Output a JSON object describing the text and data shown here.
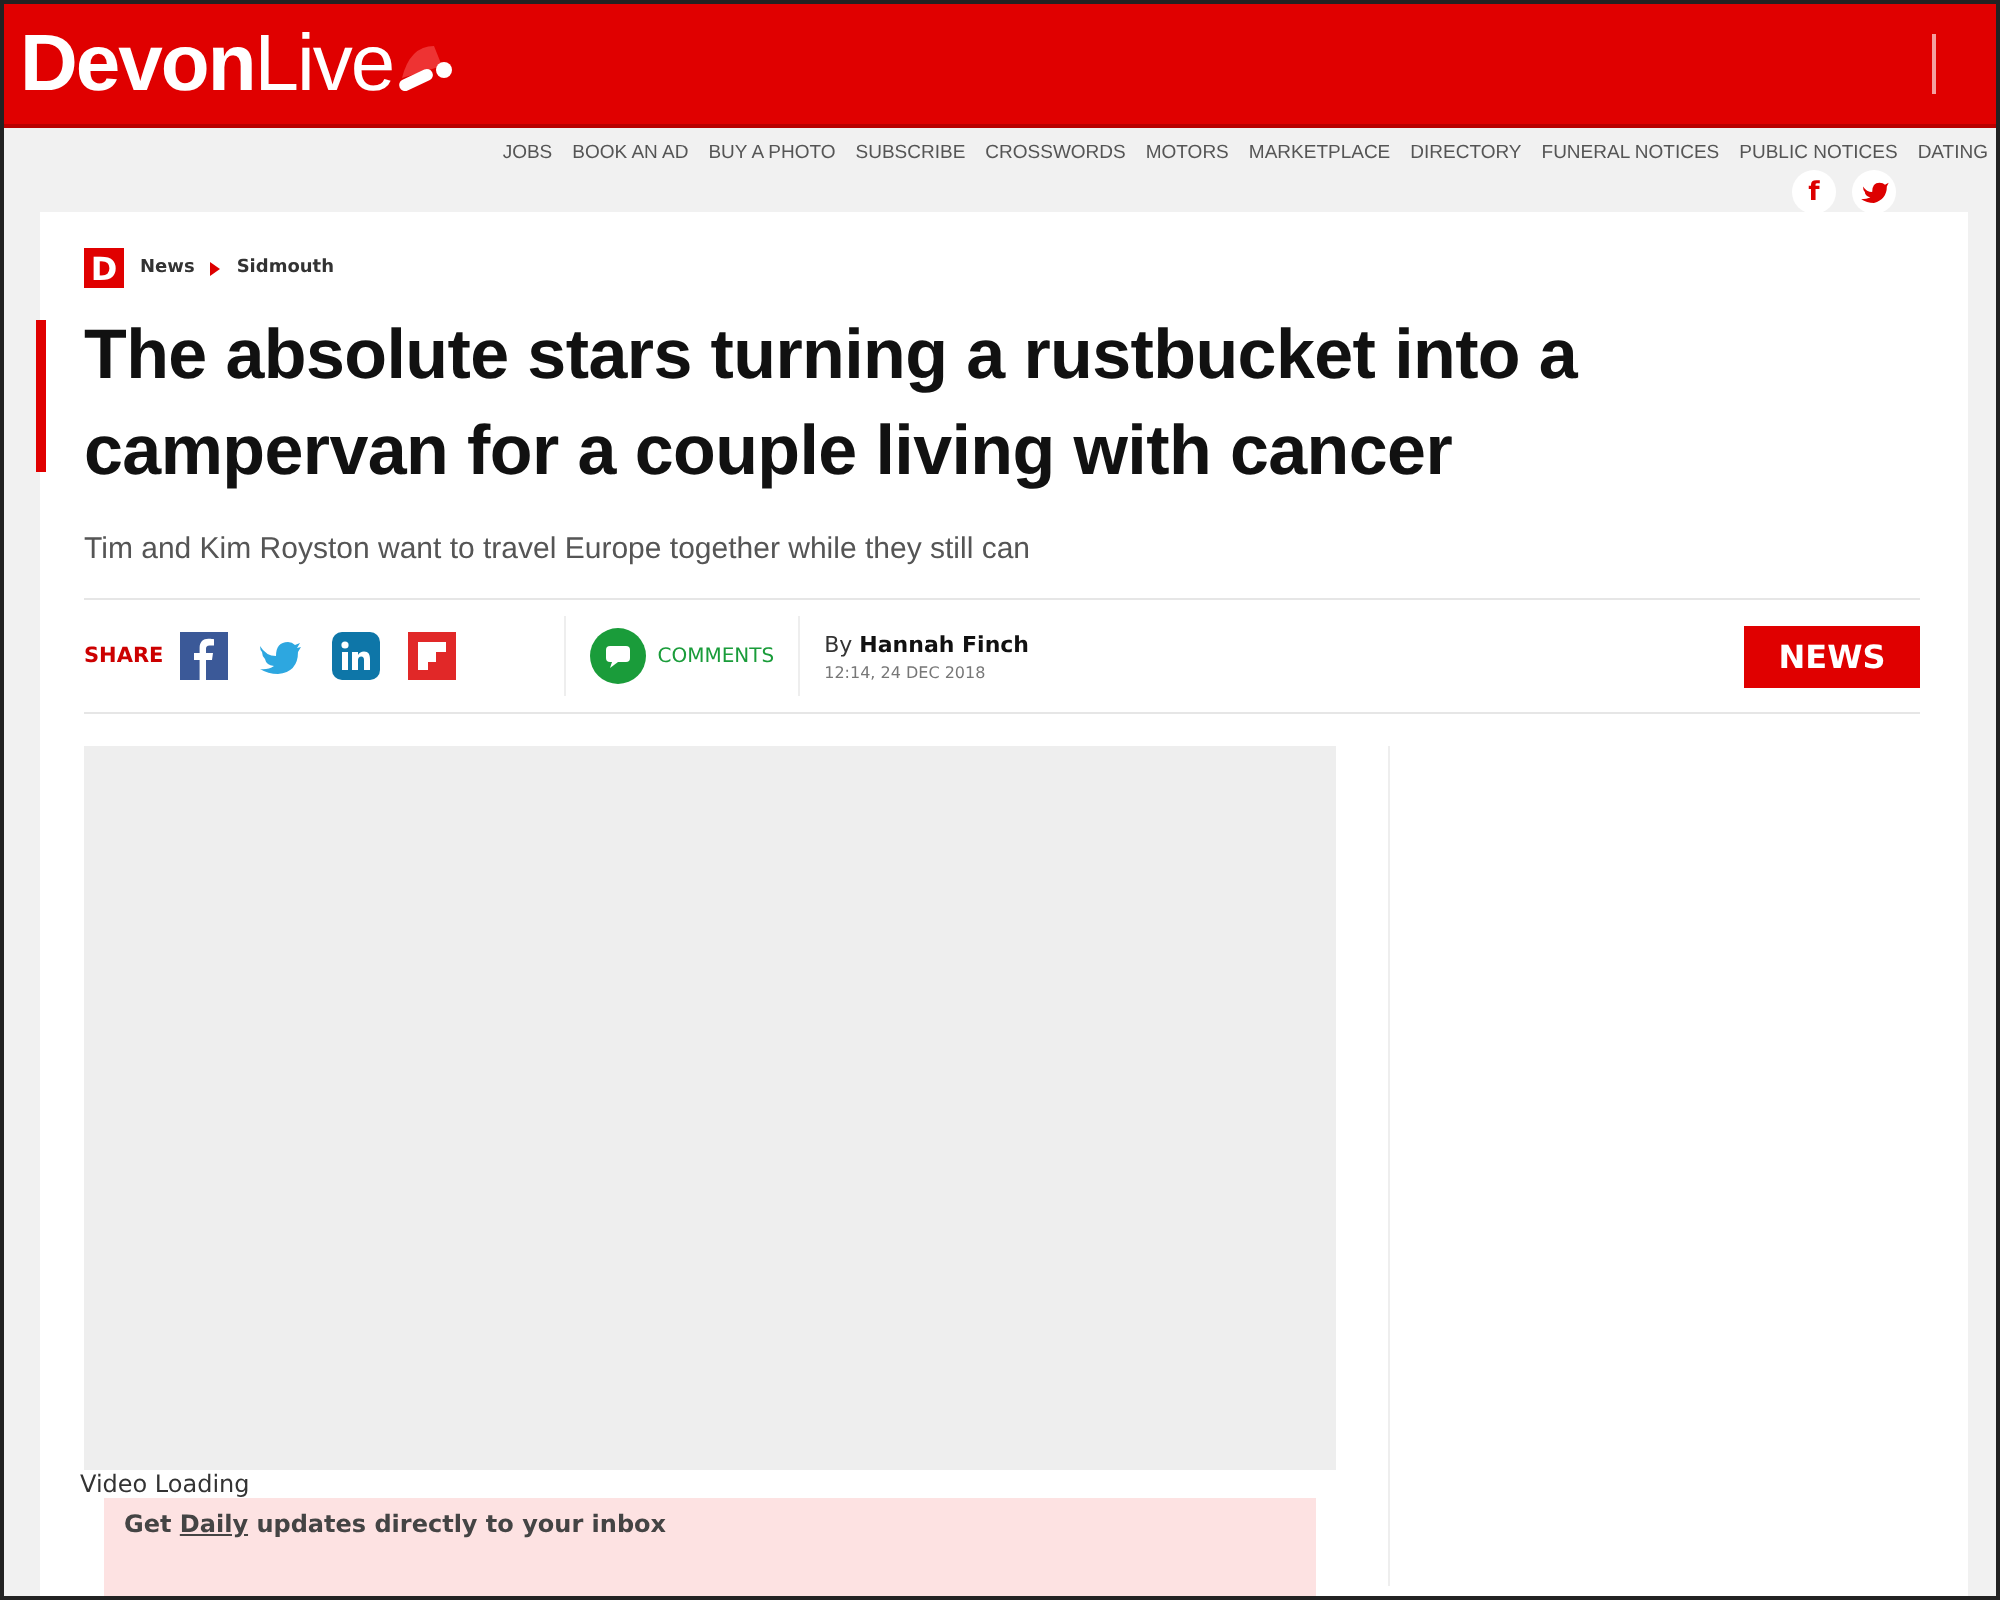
{
  "header": {
    "logo_main": "Devon",
    "logo_accent": "Live"
  },
  "top_links": [
    "JOBS",
    "BOOK AN AD",
    "BUY A PHOTO",
    "SUBSCRIBE",
    "CROSSWORDS",
    "MOTORS",
    "MARKETPLACE",
    "DIRECTORY",
    "FUNERAL NOTICES",
    "PUBLIC NOTICES",
    "DATING"
  ],
  "social": [
    "f"
  ],
  "breadcrumb": {
    "badge": "D",
    "items": [
      "News",
      "Sidmouth"
    ]
  },
  "article": {
    "headline": "The absolute stars turning a rustbucket into a campervan for a couple living with cancer",
    "standfirst": "Tim and Kim Royston want to travel Europe together while they still can",
    "share_label": "SHARE",
    "comments_label": "COMMENTS",
    "byline_prefix": "By",
    "author": "Hannah Finch",
    "date": "12:14, 24 DEC 2018",
    "section_tag": "NEWS"
  },
  "video": {
    "status": "Video Loading"
  },
  "newsletter": {
    "before": "Get ",
    "link": "Daily",
    "after": " updates directly to your inbox"
  }
}
